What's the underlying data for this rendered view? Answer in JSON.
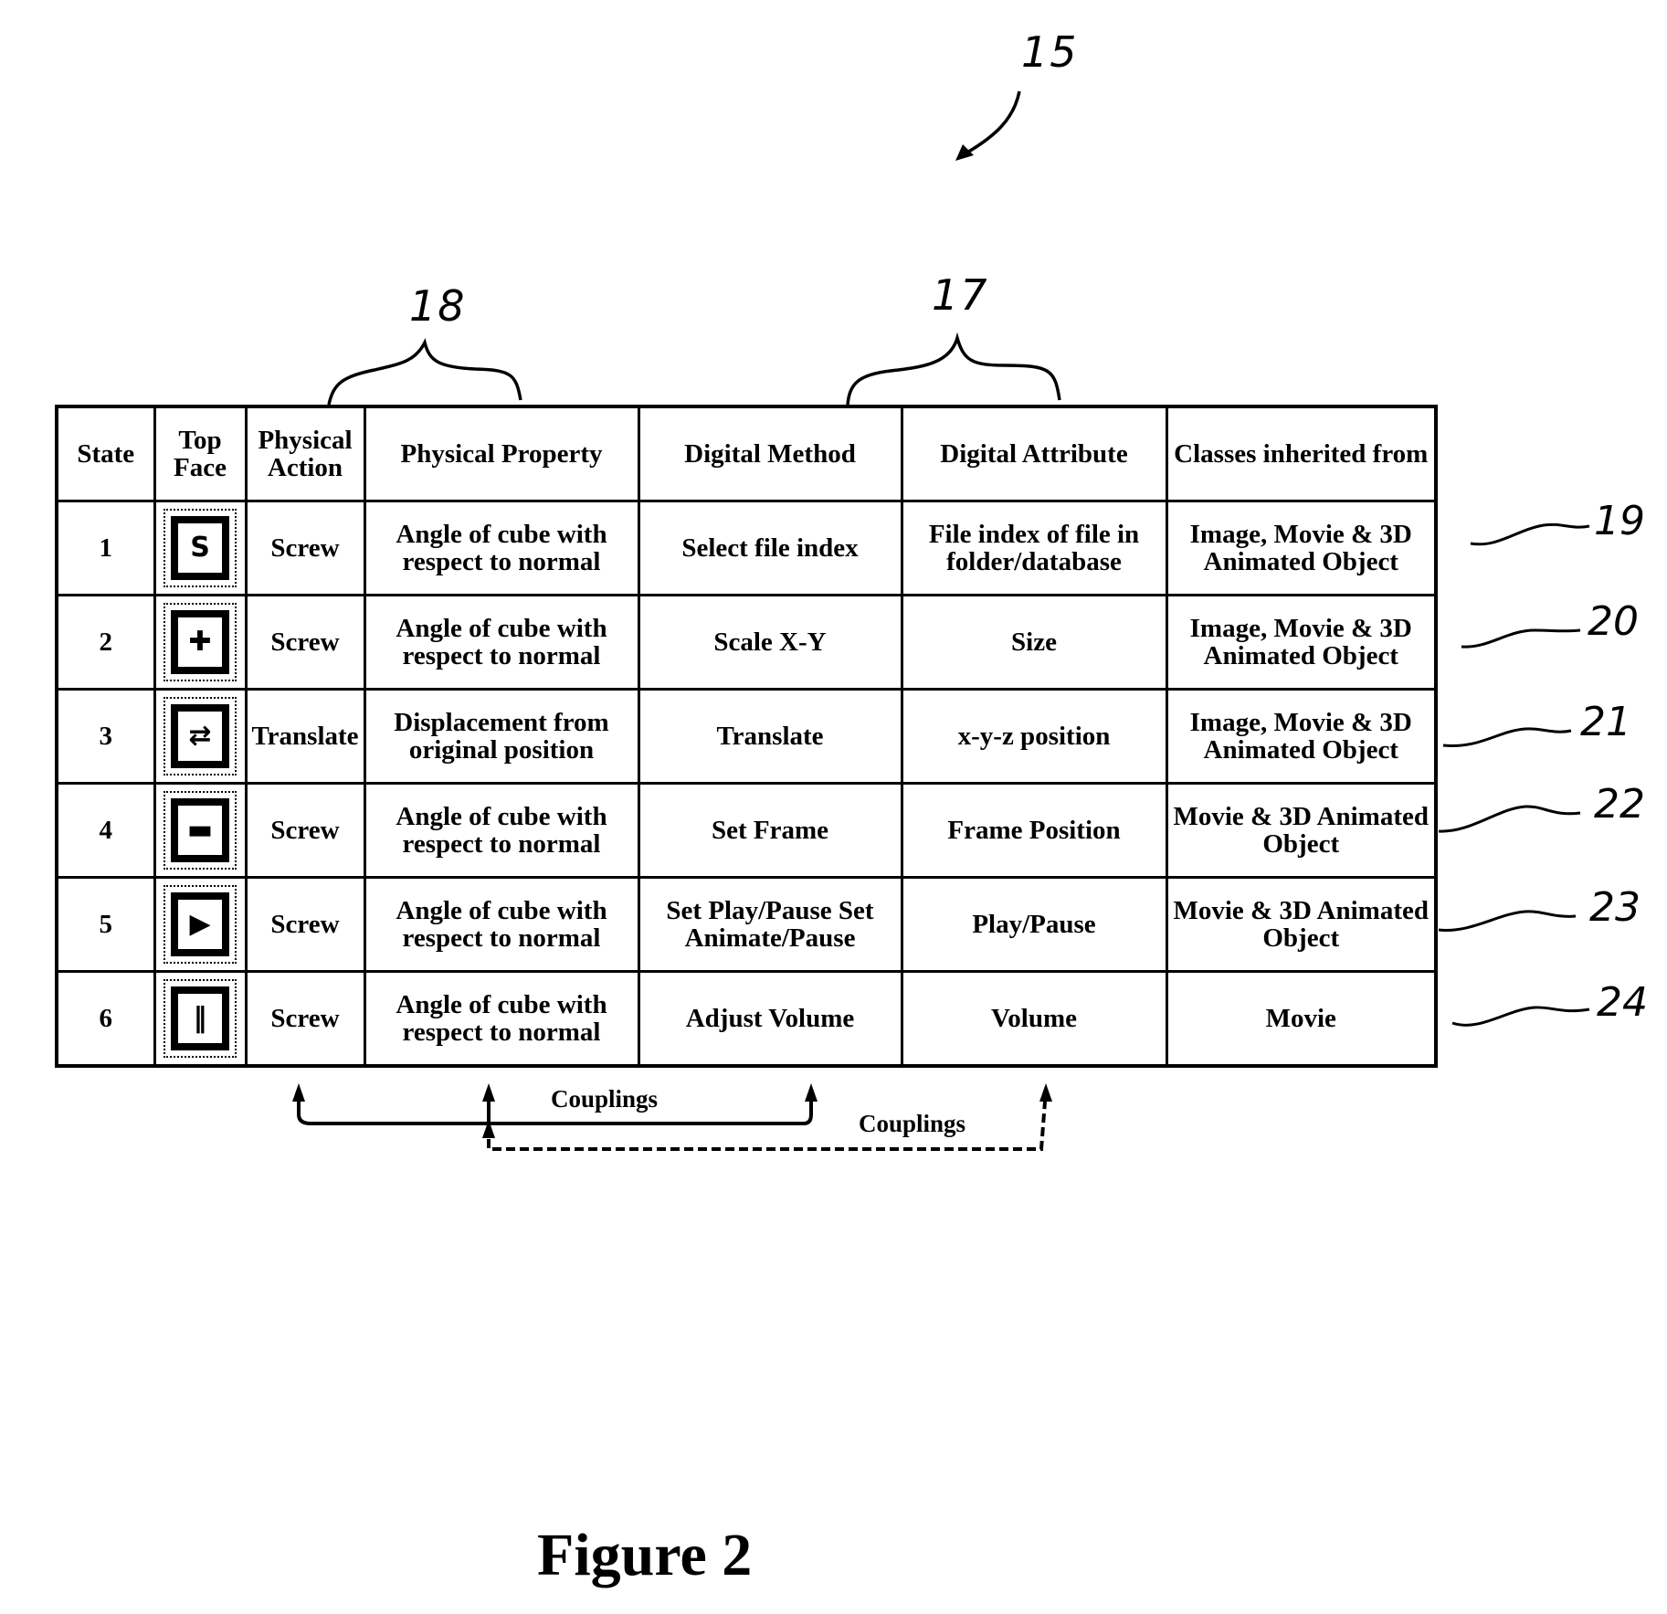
{
  "figure": {
    "title": "Figure 2",
    "reference_numerals": {
      "figure": "15",
      "digital_group": "17",
      "physical_group": "18"
    }
  },
  "table": {
    "headers": [
      "State",
      "Top Face",
      "Physical Action",
      "Physical Property",
      "Digital Method",
      "Digital Attribute",
      "Classes inherited from"
    ],
    "rows": [
      {
        "state": "1",
        "top_face_icon": "s-shape-icon",
        "top_face_glyph": "S",
        "physical_action": "Screw",
        "physical_property": "Angle of cube with respect to normal",
        "digital_method": "Select file index",
        "digital_attribute": "File index of file in folder/database",
        "classes": "Image, Movie & 3D Animated Object",
        "numeral": "19"
      },
      {
        "state": "2",
        "top_face_icon": "cross-arrows-icon",
        "top_face_glyph": "✚",
        "physical_action": "Screw",
        "physical_property": "Angle of cube with respect to normal",
        "digital_method": "Scale X-Y",
        "digital_attribute": "Size",
        "classes": "Image, Movie & 3D Animated Object",
        "numeral": "20"
      },
      {
        "state": "3",
        "top_face_icon": "translate-icon",
        "top_face_glyph": "⇄",
        "physical_action": "Translate",
        "physical_property": "Displacement from original position",
        "digital_method": "Translate",
        "digital_attribute": "x-y-z position",
        "classes": "Image, Movie & 3D Animated Object",
        "numeral": "21"
      },
      {
        "state": "4",
        "top_face_icon": "frame-icon",
        "top_face_glyph": "▬",
        "physical_action": "Screw",
        "physical_property": "Angle of cube with respect to normal",
        "digital_method": "Set Frame",
        "digital_attribute": "Frame Position",
        "classes": "Movie & 3D Animated Object",
        "numeral": "22"
      },
      {
        "state": "5",
        "top_face_icon": "play-icon",
        "top_face_glyph": "▶",
        "physical_action": "Screw",
        "physical_property": "Angle of cube with respect to normal",
        "digital_method": "Set Play/Pause Set Animate/Pause",
        "digital_attribute": "Play/Pause",
        "classes": "Movie & 3D Animated Object",
        "numeral": "23"
      },
      {
        "state": "6",
        "top_face_icon": "volume-icon",
        "top_face_glyph": "‖",
        "physical_action": "Screw",
        "physical_property": "Angle of cube with respect to normal",
        "digital_method": "Adjust Volume",
        "digital_attribute": "Volume",
        "classes": "Movie",
        "numeral": "24"
      }
    ]
  },
  "couplings": {
    "solid_label": "Couplings",
    "dashed_label": "Couplings"
  }
}
